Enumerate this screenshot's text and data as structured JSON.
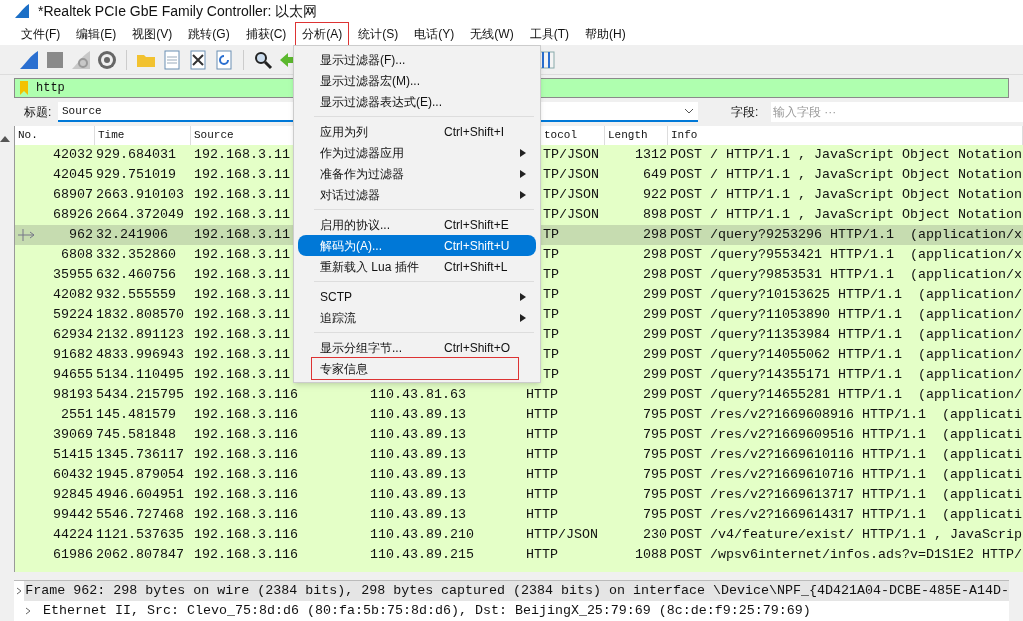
{
  "window": {
    "title": "*Realtek PCIe GbE Family Controller: 以太网"
  },
  "menubar": [
    {
      "label": "文件(F)",
      "selected": false
    },
    {
      "label": "编辑(E)",
      "selected": false
    },
    {
      "label": "视图(V)",
      "selected": false
    },
    {
      "label": "跳转(G)",
      "selected": false
    },
    {
      "label": "捕获(C)",
      "selected": false
    },
    {
      "label": "分析(A)",
      "selected": true
    },
    {
      "label": "统计(S)",
      "selected": false
    },
    {
      "label": "电话(Y)",
      "selected": false
    },
    {
      "label": "无线(W)",
      "selected": false
    },
    {
      "label": "工具(T)",
      "selected": false
    },
    {
      "label": "帮助(H)",
      "selected": false
    }
  ],
  "menu": {
    "items": [
      {
        "kind": "item",
        "label": "显示过滤器(F)...",
        "submenu": false,
        "selected": false,
        "outlined": false
      },
      {
        "kind": "item",
        "label": "显示过滤器宏(M)...",
        "submenu": false,
        "selected": false,
        "outlined": false
      },
      {
        "kind": "item",
        "label": "显示过滤器表达式(E)...",
        "submenu": false,
        "selected": false,
        "outlined": false
      },
      {
        "kind": "separator"
      },
      {
        "kind": "item",
        "label": "应用为列",
        "shortcut": "Ctrl+Shift+I",
        "submenu": false,
        "selected": false,
        "outlined": false
      },
      {
        "kind": "item",
        "label": "作为过滤器应用",
        "submenu": true,
        "selected": false,
        "outlined": false
      },
      {
        "kind": "item",
        "label": "准备作为过滤器",
        "submenu": true,
        "selected": false,
        "outlined": false
      },
      {
        "kind": "item",
        "label": "对话过滤器",
        "submenu": true,
        "selected": false,
        "outlined": false
      },
      {
        "kind": "separator"
      },
      {
        "kind": "item",
        "label": "启用的协议...",
        "shortcut": "Ctrl+Shift+E",
        "submenu": false,
        "selected": false,
        "outlined": false
      },
      {
        "kind": "item",
        "label": "解码为(A)...",
        "shortcut": "Ctrl+Shift+U",
        "submenu": false,
        "selected": true,
        "outlined": false
      },
      {
        "kind": "item",
        "label": "重新载入 Lua 插件",
        "shortcut": "Ctrl+Shift+L",
        "submenu": false,
        "selected": false,
        "outlined": false
      },
      {
        "kind": "separator"
      },
      {
        "kind": "item",
        "label": "SCTP",
        "submenu": true,
        "selected": false,
        "outlined": false
      },
      {
        "kind": "item",
        "label": "追踪流",
        "submenu": true,
        "selected": false,
        "outlined": false
      },
      {
        "kind": "separator"
      },
      {
        "kind": "item",
        "label": "显示分组字节...",
        "shortcut": "Ctrl+Shift+O",
        "submenu": false,
        "selected": false,
        "outlined": false
      },
      {
        "kind": "item",
        "label": "专家信息",
        "submenu": false,
        "selected": false,
        "outlined": true
      }
    ]
  },
  "filter": {
    "value": "http"
  },
  "column_bar": {
    "label": "标题:",
    "value": "Source",
    "field_label": "字段:",
    "field_placeholder": "输入字段 ···"
  },
  "table": {
    "columns": [
      {
        "label": "No.",
        "covered": false
      },
      {
        "label": "Time",
        "covered": false
      },
      {
        "label": "Source",
        "covered": false
      },
      {
        "label": "tocol",
        "covered": true
      },
      {
        "label": "Length",
        "covered": false
      },
      {
        "label": "Info",
        "covered": false
      }
    ],
    "rows": [
      {
        "no": "42032",
        "time": "929.684031",
        "source": "192.168.3.11",
        "protocol": "TP/JSON",
        "length": "1312",
        "info": "POST / HTTP/1.1 , JavaScript Object Notation",
        "covered": true,
        "selected": false
      },
      {
        "no": "42045",
        "time": "929.751019",
        "source": "192.168.3.11",
        "protocol": "TP/JSON",
        "length": "649",
        "info": "POST / HTTP/1.1 , JavaScript Object Notation",
        "covered": true,
        "selected": false
      },
      {
        "no": "68907",
        "time": "2663.910103",
        "source": "192.168.3.11",
        "protocol": "TP/JSON",
        "length": "922",
        "info": "POST / HTTP/1.1 , JavaScript Object Notation",
        "covered": true,
        "selected": false
      },
      {
        "no": "68926",
        "time": "2664.372049",
        "source": "192.168.3.11",
        "protocol": "TP/JSON",
        "length": "898",
        "info": "POST / HTTP/1.1 , JavaScript Object Notation",
        "covered": true,
        "selected": false
      },
      {
        "no": "962",
        "time": "32.241906",
        "source": "192.168.3.11",
        "protocol": "TP",
        "length": "298",
        "info": "POST /query?9253296 HTTP/1.1  (application/x",
        "covered": true,
        "selected": true
      },
      {
        "no": "6808",
        "time": "332.352860",
        "source": "192.168.3.11",
        "protocol": "TP",
        "length": "298",
        "info": "POST /query?9553421 HTTP/1.1  (application/x",
        "covered": true,
        "selected": false
      },
      {
        "no": "35955",
        "time": "632.460756",
        "source": "192.168.3.11",
        "protocol": "TP",
        "length": "298",
        "info": "POST /query?9853531 HTTP/1.1  (application/x",
        "covered": true,
        "selected": false
      },
      {
        "no": "42082",
        "time": "932.555559",
        "source": "192.168.3.11",
        "protocol": "TP",
        "length": "299",
        "info": "POST /query?10153625 HTTP/1.1  (application/",
        "covered": true,
        "selected": false
      },
      {
        "no": "59224",
        "time": "1832.808570",
        "source": "192.168.3.11",
        "protocol": "TP",
        "length": "299",
        "info": "POST /query?11053890 HTTP/1.1  (application/",
        "covered": true,
        "selected": false
      },
      {
        "no": "62934",
        "time": "2132.891123",
        "source": "192.168.3.11",
        "protocol": "TP",
        "length": "299",
        "info": "POST /query?11353984 HTTP/1.1  (application/",
        "covered": true,
        "selected": false
      },
      {
        "no": "91682",
        "time": "4833.996943",
        "source": "192.168.3.11",
        "protocol": "TP",
        "length": "299",
        "info": "POST /query?14055062 HTTP/1.1  (application/",
        "covered": true,
        "selected": false
      },
      {
        "no": "94655",
        "time": "5134.110495",
        "source": "192.168.3.11",
        "protocol": "TP",
        "length": "299",
        "info": "POST /query?14355171 HTTP/1.1  (application/",
        "covered": true,
        "selected": false
      },
      {
        "no": "98193",
        "time": "5434.215795",
        "source": "192.168.3.116",
        "destination": "110.43.81.63",
        "protocol": "HTTP",
        "length": "299",
        "info": "POST /query?14655281 HTTP/1.1  (application/",
        "covered": false,
        "selected": false
      },
      {
        "no": "2551",
        "time": "145.481579",
        "source": "192.168.3.116",
        "destination": "110.43.89.13",
        "protocol": "HTTP",
        "length": "795",
        "info": "POST /res/v2?1669608916 HTTP/1.1  (applicati",
        "covered": false,
        "selected": false
      },
      {
        "no": "39069",
        "time": "745.581848",
        "source": "192.168.3.116",
        "destination": "110.43.89.13",
        "protocol": "HTTP",
        "length": "795",
        "info": "POST /res/v2?1669609516 HTTP/1.1  (applicati",
        "covered": false,
        "selected": false
      },
      {
        "no": "51415",
        "time": "1345.736117",
        "source": "192.168.3.116",
        "destination": "110.43.89.13",
        "protocol": "HTTP",
        "length": "795",
        "info": "POST /res/v2?1669610116 HTTP/1.1  (applicati",
        "covered": false,
        "selected": false
      },
      {
        "no": "60432",
        "time": "1945.879054",
        "source": "192.168.3.116",
        "destination": "110.43.89.13",
        "protocol": "HTTP",
        "length": "795",
        "info": "POST /res/v2?1669610716 HTTP/1.1  (applicati",
        "covered": false,
        "selected": false
      },
      {
        "no": "92845",
        "time": "4946.604951",
        "source": "192.168.3.116",
        "destination": "110.43.89.13",
        "protocol": "HTTP",
        "length": "795",
        "info": "POST /res/v2?1669613717 HTTP/1.1  (applicati",
        "covered": false,
        "selected": false
      },
      {
        "no": "99442",
        "time": "5546.727468",
        "source": "192.168.3.116",
        "destination": "110.43.89.13",
        "protocol": "HTTP",
        "length": "795",
        "info": "POST /res/v2?1669614317 HTTP/1.1  (applicati",
        "covered": false,
        "selected": false
      },
      {
        "no": "44224",
        "time": "1121.537635",
        "source": "192.168.3.116",
        "destination": "110.43.89.210",
        "protocol": "HTTP/JSON",
        "length": "230",
        "info": "POST /v4/feature/exist/ HTTP/1.1 , JavaScrip",
        "covered": false,
        "selected": false
      },
      {
        "no": "61986",
        "time": "2062.807847",
        "source": "192.168.3.116",
        "destination": "110.43.89.215",
        "protocol": "HTTP",
        "length": "1088",
        "info": "POST /wpsv6internet/infos.ads?v=D1S1E2 HTTP/",
        "covered": false,
        "selected": false
      }
    ]
  },
  "details": [
    {
      "text": "Frame 962: 298 bytes on wire (2384 bits), 298 bytes captured (2384 bits) on interface \\Device\\NPF_{4D421A04-DCBE-485E-A14D-",
      "expanded": false,
      "selected": true
    },
    {
      "text": "Ethernet II, Src: Clevo_75:8d:d6 (80:fa:5b:75:8d:d6), Dst: BeijingX_25:79:69 (8c:de:f9:25:79:69)",
      "expanded": false,
      "selected": false
    }
  ]
}
